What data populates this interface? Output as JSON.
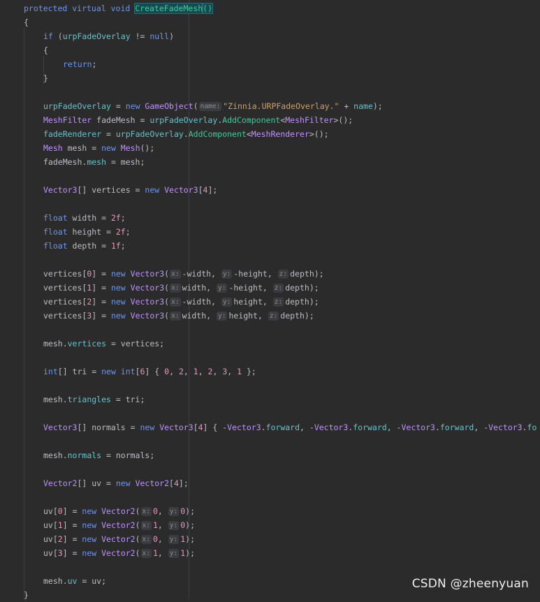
{
  "colors": {
    "background": "#2b2b2b",
    "keyword": "#6c95eb",
    "type": "#c191ff",
    "method": "#39cc9b",
    "field": "#66c3cc",
    "string": "#c9a26d",
    "number": "#ed94c0",
    "plain": "#bcbec4",
    "hint_bg": "#3a3c40"
  },
  "editor": {
    "lines": [
      {
        "indent": 0,
        "tokens": [
          [
            "kw",
            "protected virtual void "
          ],
          [
            "hl",
            "CreateFadeMesh"
          ],
          [
            "hl",
            "()"
          ]
        ]
      },
      {
        "indent": 0,
        "tokens": [
          [
            "plain",
            "{"
          ]
        ]
      },
      {
        "indent": 1,
        "tokens": [
          [
            "kw",
            "if "
          ],
          [
            "plain",
            "("
          ],
          [
            "fld",
            "urpFadeOverlay"
          ],
          [
            "plain",
            " != "
          ],
          [
            "kw",
            "null"
          ],
          [
            "plain",
            ")"
          ]
        ]
      },
      {
        "indent": 1,
        "tokens": [
          [
            "plain",
            "{"
          ]
        ]
      },
      {
        "indent": 2,
        "tokens": [
          [
            "kw",
            "return"
          ],
          [
            "plain",
            ";"
          ]
        ]
      },
      {
        "indent": 1,
        "tokens": [
          [
            "plain",
            "}"
          ]
        ]
      },
      {
        "indent": 1,
        "tokens": []
      },
      {
        "indent": 1,
        "tokens": [
          [
            "fld",
            "urpFadeOverlay"
          ],
          [
            "plain",
            " = "
          ],
          [
            "kw",
            "new "
          ],
          [
            "ty",
            "GameObject"
          ],
          [
            "plain",
            "("
          ],
          [
            "hint",
            "name:"
          ],
          [
            "str",
            "\"Zinnia.URPFadeOverlay.\""
          ],
          [
            "plain",
            " + "
          ],
          [
            "fld",
            "name"
          ],
          [
            "plain",
            ");"
          ]
        ]
      },
      {
        "indent": 1,
        "tokens": [
          [
            "ty",
            "MeshFilter"
          ],
          [
            "plain",
            " fadeMesh = "
          ],
          [
            "fld",
            "urpFadeOverlay"
          ],
          [
            "plain",
            "."
          ],
          [
            "fn",
            "AddComponent"
          ],
          [
            "plain",
            "<"
          ],
          [
            "ty",
            "MeshFilter"
          ],
          [
            "plain",
            ">();"
          ]
        ]
      },
      {
        "indent": 1,
        "tokens": [
          [
            "fld",
            "fadeRenderer"
          ],
          [
            "plain",
            " = "
          ],
          [
            "fld",
            "urpFadeOverlay"
          ],
          [
            "plain",
            "."
          ],
          [
            "fn",
            "AddComponent"
          ],
          [
            "plain",
            "<"
          ],
          [
            "ty",
            "MeshRenderer"
          ],
          [
            "plain",
            ">();"
          ]
        ]
      },
      {
        "indent": 1,
        "tokens": [
          [
            "ty",
            "Mesh"
          ],
          [
            "plain",
            " mesh = "
          ],
          [
            "kw",
            "new "
          ],
          [
            "ty",
            "Mesh"
          ],
          [
            "plain",
            "();"
          ]
        ]
      },
      {
        "indent": 1,
        "tokens": [
          [
            "plain",
            "fadeMesh."
          ],
          [
            "fld",
            "mesh"
          ],
          [
            "plain",
            " = mesh;"
          ]
        ]
      },
      {
        "indent": 1,
        "tokens": []
      },
      {
        "indent": 1,
        "tokens": [
          [
            "ty",
            "Vector3"
          ],
          [
            "plain",
            "[] vertices = "
          ],
          [
            "kw",
            "new "
          ],
          [
            "ty",
            "Vector3"
          ],
          [
            "plain",
            "["
          ],
          [
            "num",
            "4"
          ],
          [
            "plain",
            "];"
          ]
        ]
      },
      {
        "indent": 1,
        "tokens": []
      },
      {
        "indent": 1,
        "tokens": [
          [
            "kw",
            "float"
          ],
          [
            "plain",
            " width = "
          ],
          [
            "num",
            "2f"
          ],
          [
            "plain",
            ";"
          ]
        ]
      },
      {
        "indent": 1,
        "tokens": [
          [
            "kw",
            "float"
          ],
          [
            "plain",
            " height = "
          ],
          [
            "num",
            "2f"
          ],
          [
            "plain",
            ";"
          ]
        ]
      },
      {
        "indent": 1,
        "tokens": [
          [
            "kw",
            "float"
          ],
          [
            "plain",
            " depth = "
          ],
          [
            "num",
            "1f"
          ],
          [
            "plain",
            ";"
          ]
        ]
      },
      {
        "indent": 1,
        "tokens": []
      },
      {
        "indent": 1,
        "tokens": [
          [
            "plain",
            "vertices["
          ],
          [
            "num",
            "0"
          ],
          [
            "plain",
            "] = "
          ],
          [
            "kw",
            "new "
          ],
          [
            "ty",
            "Vector3"
          ],
          [
            "plain",
            "("
          ],
          [
            "hint",
            "x:"
          ],
          [
            "plain",
            "-width, "
          ],
          [
            "hint",
            "y:"
          ],
          [
            "plain",
            "-height, "
          ],
          [
            "hint",
            "z:"
          ],
          [
            "plain",
            "depth);"
          ]
        ]
      },
      {
        "indent": 1,
        "tokens": [
          [
            "plain",
            "vertices["
          ],
          [
            "num",
            "1"
          ],
          [
            "plain",
            "] = "
          ],
          [
            "kw",
            "new "
          ],
          [
            "ty",
            "Vector3"
          ],
          [
            "plain",
            "("
          ],
          [
            "hint",
            "x:"
          ],
          [
            "plain",
            "width, "
          ],
          [
            "hint",
            "y:"
          ],
          [
            "plain",
            "-height, "
          ],
          [
            "hint",
            "z:"
          ],
          [
            "plain",
            "depth);"
          ]
        ]
      },
      {
        "indent": 1,
        "tokens": [
          [
            "plain",
            "vertices["
          ],
          [
            "num",
            "2"
          ],
          [
            "plain",
            "] = "
          ],
          [
            "kw",
            "new "
          ],
          [
            "ty",
            "Vector3"
          ],
          [
            "plain",
            "("
          ],
          [
            "hint",
            "x:"
          ],
          [
            "plain",
            "-width, "
          ],
          [
            "hint",
            "y:"
          ],
          [
            "plain",
            "height, "
          ],
          [
            "hint",
            "z:"
          ],
          [
            "plain",
            "depth);"
          ]
        ]
      },
      {
        "indent": 1,
        "tokens": [
          [
            "plain",
            "vertices["
          ],
          [
            "num",
            "3"
          ],
          [
            "plain",
            "] = "
          ],
          [
            "kw",
            "new "
          ],
          [
            "ty",
            "Vector3"
          ],
          [
            "plain",
            "("
          ],
          [
            "hint",
            "x:"
          ],
          [
            "plain",
            "width, "
          ],
          [
            "hint",
            "y:"
          ],
          [
            "plain",
            "height, "
          ],
          [
            "hint",
            "z:"
          ],
          [
            "plain",
            "depth);"
          ]
        ]
      },
      {
        "indent": 1,
        "tokens": []
      },
      {
        "indent": 1,
        "tokens": [
          [
            "plain",
            "mesh."
          ],
          [
            "fld",
            "vertices"
          ],
          [
            "plain",
            " = vertices;"
          ]
        ]
      },
      {
        "indent": 1,
        "tokens": []
      },
      {
        "indent": 1,
        "tokens": [
          [
            "kw",
            "int"
          ],
          [
            "plain",
            "[] tri = "
          ],
          [
            "kw",
            "new "
          ],
          [
            "kw",
            "int"
          ],
          [
            "plain",
            "["
          ],
          [
            "num",
            "6"
          ],
          [
            "plain",
            "] { "
          ],
          [
            "num",
            "0"
          ],
          [
            "plain",
            ", "
          ],
          [
            "num",
            "2"
          ],
          [
            "plain",
            ", "
          ],
          [
            "num",
            "1"
          ],
          [
            "plain",
            ", "
          ],
          [
            "num",
            "2"
          ],
          [
            "plain",
            ", "
          ],
          [
            "num",
            "3"
          ],
          [
            "plain",
            ", "
          ],
          [
            "num",
            "1"
          ],
          [
            "plain",
            " };"
          ]
        ]
      },
      {
        "indent": 1,
        "tokens": []
      },
      {
        "indent": 1,
        "tokens": [
          [
            "plain",
            "mesh."
          ],
          [
            "fld",
            "triangles"
          ],
          [
            "plain",
            " = tri;"
          ]
        ]
      },
      {
        "indent": 1,
        "tokens": []
      },
      {
        "indent": 1,
        "tokens": [
          [
            "ty",
            "Vector3"
          ],
          [
            "plain",
            "[] normals = "
          ],
          [
            "kw",
            "new "
          ],
          [
            "ty",
            "Vector3"
          ],
          [
            "plain",
            "["
          ],
          [
            "num",
            "4"
          ],
          [
            "plain",
            "] { -"
          ],
          [
            "ty",
            "Vector3"
          ],
          [
            "plain",
            "."
          ],
          [
            "fld",
            "forward"
          ],
          [
            "plain",
            ", -"
          ],
          [
            "ty",
            "Vector3"
          ],
          [
            "plain",
            "."
          ],
          [
            "fld",
            "forward"
          ],
          [
            "plain",
            ", -"
          ],
          [
            "ty",
            "Vector3"
          ],
          [
            "plain",
            "."
          ],
          [
            "fld",
            "forward"
          ],
          [
            "plain",
            ", -"
          ],
          [
            "ty",
            "Vector3"
          ],
          [
            "plain",
            "."
          ],
          [
            "fld",
            "fo"
          ]
        ]
      },
      {
        "indent": 1,
        "tokens": []
      },
      {
        "indent": 1,
        "tokens": [
          [
            "plain",
            "mesh."
          ],
          [
            "fld",
            "normals"
          ],
          [
            "plain",
            " = normals;"
          ]
        ]
      },
      {
        "indent": 1,
        "tokens": []
      },
      {
        "indent": 1,
        "tokens": [
          [
            "ty",
            "Vector2"
          ],
          [
            "plain",
            "[] uv = "
          ],
          [
            "kw",
            "new "
          ],
          [
            "ty",
            "Vector2"
          ],
          [
            "plain",
            "["
          ],
          [
            "num",
            "4"
          ],
          [
            "plain",
            "];"
          ]
        ]
      },
      {
        "indent": 1,
        "tokens": []
      },
      {
        "indent": 1,
        "tokens": [
          [
            "plain",
            "uv["
          ],
          [
            "num",
            "0"
          ],
          [
            "plain",
            "] = "
          ],
          [
            "kw",
            "new "
          ],
          [
            "ty",
            "Vector2"
          ],
          [
            "plain",
            "("
          ],
          [
            "hint",
            "x:"
          ],
          [
            "num",
            "0"
          ],
          [
            "plain",
            ", "
          ],
          [
            "hint",
            "y:"
          ],
          [
            "num",
            "0"
          ],
          [
            "plain",
            ");"
          ]
        ]
      },
      {
        "indent": 1,
        "tokens": [
          [
            "plain",
            "uv["
          ],
          [
            "num",
            "1"
          ],
          [
            "plain",
            "] = "
          ],
          [
            "kw",
            "new "
          ],
          [
            "ty",
            "Vector2"
          ],
          [
            "plain",
            "("
          ],
          [
            "hint",
            "x:"
          ],
          [
            "num",
            "1"
          ],
          [
            "plain",
            ", "
          ],
          [
            "hint",
            "y:"
          ],
          [
            "num",
            "0"
          ],
          [
            "plain",
            ");"
          ]
        ]
      },
      {
        "indent": 1,
        "tokens": [
          [
            "plain",
            "uv["
          ],
          [
            "num",
            "2"
          ],
          [
            "plain",
            "] = "
          ],
          [
            "kw",
            "new "
          ],
          [
            "ty",
            "Vector2"
          ],
          [
            "plain",
            "("
          ],
          [
            "hint",
            "x:"
          ],
          [
            "num",
            "0"
          ],
          [
            "plain",
            ", "
          ],
          [
            "hint",
            "y:"
          ],
          [
            "num",
            "1"
          ],
          [
            "plain",
            ");"
          ]
        ]
      },
      {
        "indent": 1,
        "tokens": [
          [
            "plain",
            "uv["
          ],
          [
            "num",
            "3"
          ],
          [
            "plain",
            "] = "
          ],
          [
            "kw",
            "new "
          ],
          [
            "ty",
            "Vector2"
          ],
          [
            "plain",
            "("
          ],
          [
            "hint",
            "x:"
          ],
          [
            "num",
            "1"
          ],
          [
            "plain",
            ", "
          ],
          [
            "hint",
            "y:"
          ],
          [
            "num",
            "1"
          ],
          [
            "plain",
            ");"
          ]
        ]
      },
      {
        "indent": 1,
        "tokens": []
      },
      {
        "indent": 1,
        "tokens": [
          [
            "plain",
            "mesh."
          ],
          [
            "fld",
            "uv"
          ],
          [
            "plain",
            " = uv;"
          ]
        ]
      },
      {
        "indent": 0,
        "tokens": [
          [
            "plain",
            "}"
          ]
        ]
      }
    ]
  },
  "watermark": "CSDN @zheenyuan"
}
